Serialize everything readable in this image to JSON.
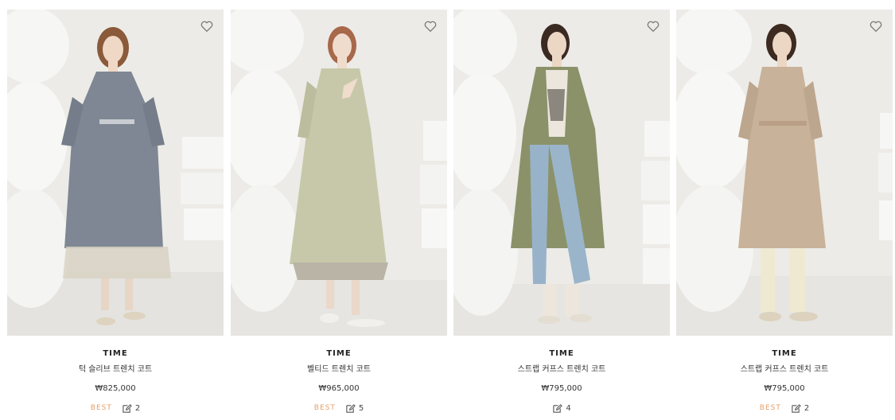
{
  "products": [
    {
      "brand": "TIME",
      "name": "턱 슬리브 트렌치 코트",
      "price": "₩825,000",
      "badge": "BEST",
      "review_count": "2",
      "coat_color": "#7e8793",
      "skirt_color": "#d8d2c3",
      "legs_color": "#e7d5c6"
    },
    {
      "brand": "TIME",
      "name": "벨티드 트렌치 코트",
      "price": "₩965,000",
      "badge": "BEST",
      "review_count": "5",
      "coat_color": "#c7c8a9",
      "skirt_color": "#b9b4a6",
      "legs_color": "#ead8c9"
    },
    {
      "brand": "TIME",
      "name": "스트랩 커프스 트렌치 코트",
      "price": "₩795,000",
      "badge": "",
      "review_count": "4",
      "coat_color": "#8b926a",
      "skirt_color": "#98b3c9",
      "legs_color": "#98b3c9"
    },
    {
      "brand": "TIME",
      "name": "스트랩 커프스 트렌치 코트",
      "price": "₩795,000",
      "badge": "BEST",
      "review_count": "2",
      "coat_color": "#c9b29a",
      "skirt_color": "#efe9d2",
      "legs_color": "#efe9d2"
    }
  ],
  "colors": {
    "best": "#e3a06a",
    "photo_bg": "#ecebe7",
    "prop": "#f6f6f4"
  }
}
